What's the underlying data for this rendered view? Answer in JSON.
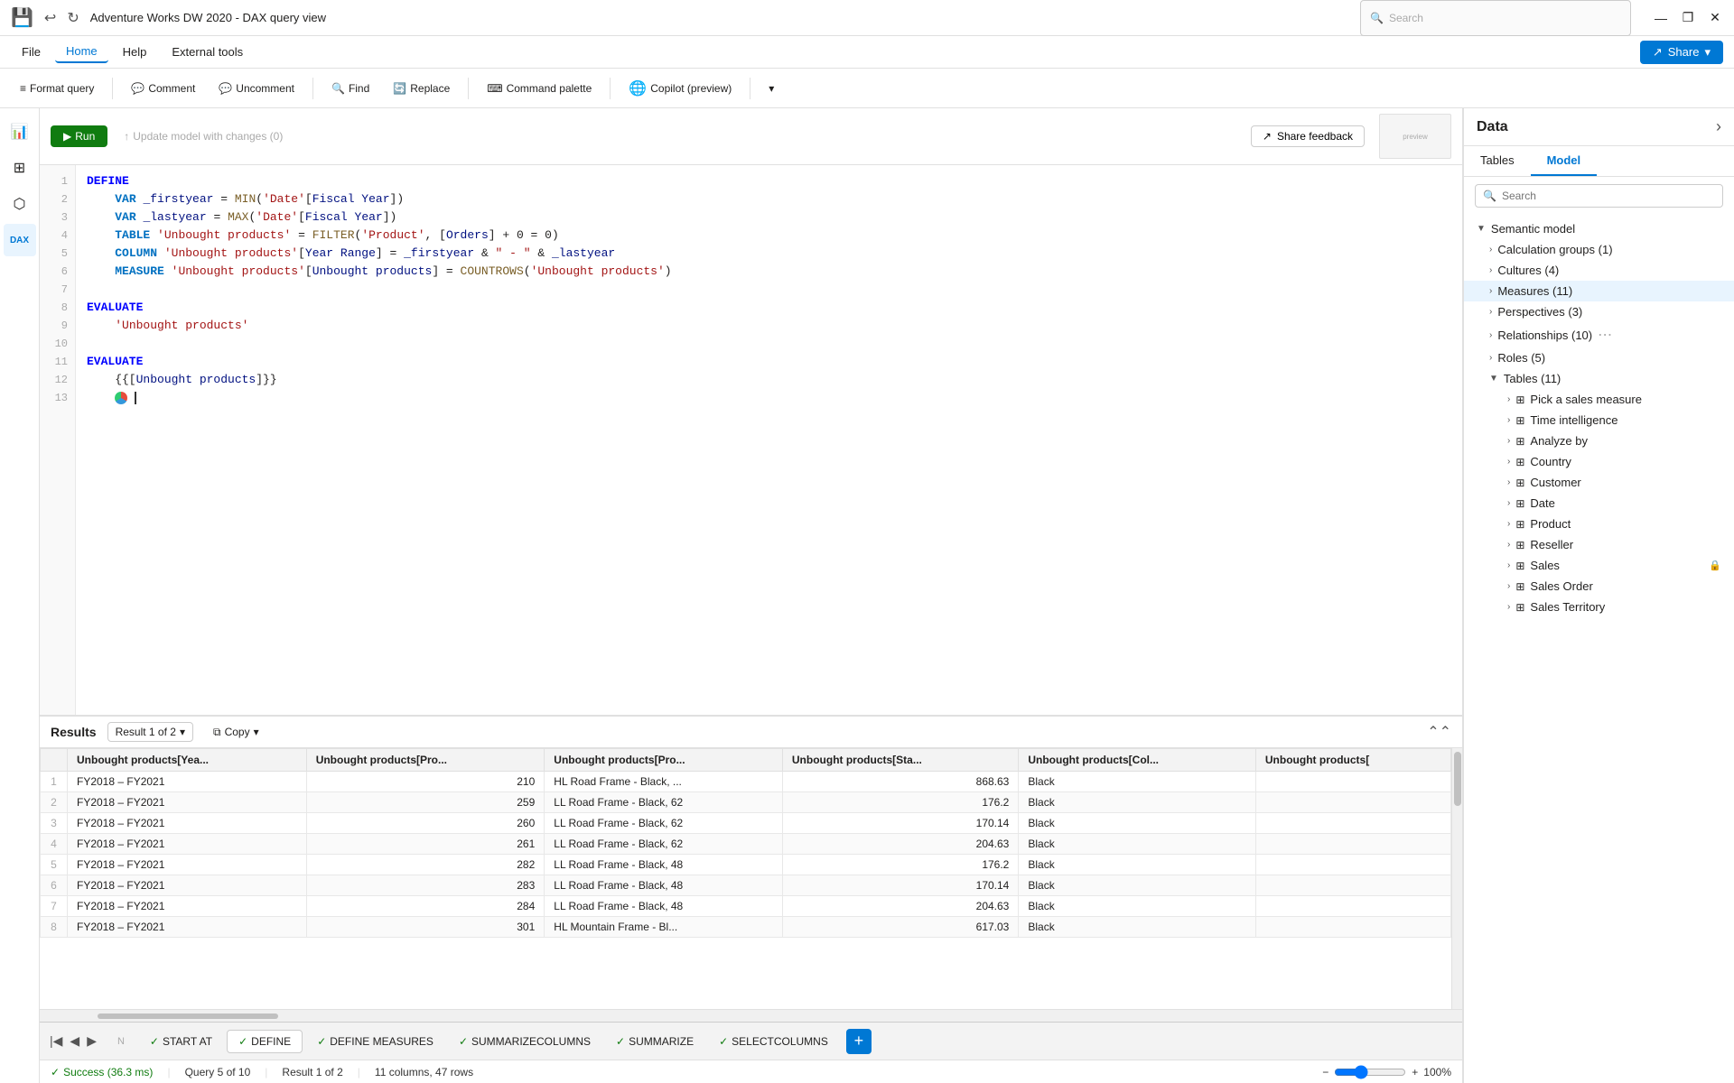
{
  "title_bar": {
    "title": "Adventure Works DW 2020 - DAX query view",
    "search_placeholder": "Search",
    "win_min": "—",
    "win_max": "❐",
    "win_close": "✕"
  },
  "menu": {
    "items": [
      "File",
      "Home",
      "Help",
      "External tools"
    ],
    "active": "Home",
    "share_label": "Share"
  },
  "toolbar": {
    "format_query": "Format query",
    "comment": "Comment",
    "uncomment": "Uncomment",
    "find": "Find",
    "replace": "Replace",
    "command_palette": "Command palette",
    "copilot": "Copilot (preview)",
    "run": "Run",
    "update_model": "Update model with changes (0)"
  },
  "feedback": {
    "share_feedback": "Share feedback"
  },
  "code": {
    "lines": [
      {
        "num": 1,
        "text": "DEFINE",
        "type": "keyword"
      },
      {
        "num": 2,
        "text": "    VAR _firstyear = MIN('Date'[Fiscal Year])",
        "type": "code"
      },
      {
        "num": 3,
        "text": "    VAR _lastyear = MAX('Date'[Fiscal Year])",
        "type": "code"
      },
      {
        "num": 4,
        "text": "    TABLE 'Unbought products' = FILTER('Product', [Orders] + 0 = 0)",
        "type": "code"
      },
      {
        "num": 5,
        "text": "    COLUMN 'Unbought products'[Year Range] = _firstyear & \" - \" & _lastyear",
        "type": "code"
      },
      {
        "num": 6,
        "text": "    MEASURE 'Unbought products'[Unbought products] = COUNTROWS('Unbought products')",
        "type": "code"
      },
      {
        "num": 7,
        "text": "",
        "type": "empty"
      },
      {
        "num": 8,
        "text": "EVALUATE",
        "type": "keyword"
      },
      {
        "num": 9,
        "text": "    'Unbought products'",
        "type": "code"
      },
      {
        "num": 10,
        "text": "",
        "type": "empty"
      },
      {
        "num": 11,
        "text": "EVALUATE",
        "type": "keyword"
      },
      {
        "num": 12,
        "text": "    {{[Unbought products]}}",
        "type": "code"
      },
      {
        "num": 13,
        "text": "    ",
        "type": "cursor"
      }
    ]
  },
  "results": {
    "title": "Results",
    "result_selector": "Result 1 of 2",
    "copy_label": "Copy",
    "columns": [
      "Unbought products[Yea...",
      "Unbought products[Pro...",
      "Unbought products[Pro...",
      "Unbought products[Sta...",
      "Unbought products[Col...",
      "Unbought products["
    ],
    "rows": [
      {
        "num": 1,
        "c1": "FY2018 – FY2021",
        "c2": "210",
        "c3": "HL Road Frame - Black, ...",
        "c4": "868.63",
        "c5": "Black",
        "c6": ""
      },
      {
        "num": 2,
        "c1": "FY2018 – FY2021",
        "c2": "259",
        "c3": "LL Road Frame - Black, 62",
        "c4": "176.2",
        "c5": "Black",
        "c6": ""
      },
      {
        "num": 3,
        "c1": "FY2018 – FY2021",
        "c2": "260",
        "c3": "LL Road Frame - Black, 62",
        "c4": "170.14",
        "c5": "Black",
        "c6": ""
      },
      {
        "num": 4,
        "c1": "FY2018 – FY2021",
        "c2": "261",
        "c3": "LL Road Frame - Black, 62",
        "c4": "204.63",
        "c5": "Black",
        "c6": ""
      },
      {
        "num": 5,
        "c1": "FY2018 – FY2021",
        "c2": "282",
        "c3": "LL Road Frame - Black, 48",
        "c4": "176.2",
        "c5": "Black",
        "c6": ""
      },
      {
        "num": 6,
        "c1": "FY2018 – FY2021",
        "c2": "283",
        "c3": "LL Road Frame - Black, 48",
        "c4": "170.14",
        "c5": "Black",
        "c6": ""
      },
      {
        "num": 7,
        "c1": "FY2018 – FY2021",
        "c2": "284",
        "c3": "LL Road Frame - Black, 48",
        "c4": "204.63",
        "c5": "Black",
        "c6": ""
      },
      {
        "num": 8,
        "c1": "FY2018 – FY2021",
        "c2": "301",
        "c3": "HL Mountain Frame - Bl...",
        "c4": "617.03",
        "c5": "Black",
        "c6": ""
      }
    ]
  },
  "bottom_tabs": {
    "items": [
      "N",
      "START AT",
      "DEFINE",
      "DEFINE MEASURES",
      "SUMMARIZECOLUMNS",
      "SUMMARIZE",
      "SELECTCOLUMNS"
    ],
    "active": "DEFINE"
  },
  "status_bar": {
    "success_text": "Success (36.3 ms)",
    "query_text": "Query 5 of 10",
    "result_text": "Result 1 of 2",
    "columns_rows": "11 columns, 47 rows",
    "zoom": "100%"
  },
  "data_panel": {
    "title": "Data",
    "tabs": [
      "Tables",
      "Model"
    ],
    "active_tab": "Model",
    "search_placeholder": "Search",
    "tree": [
      {
        "label": "Semantic model",
        "type": "root",
        "expanded": true
      },
      {
        "label": "Calculation groups (1)",
        "type": "child",
        "level": 1
      },
      {
        "label": "Cultures (4)",
        "type": "child",
        "level": 1
      },
      {
        "label": "Measures (11)",
        "type": "child",
        "level": 1,
        "active": true
      },
      {
        "label": "Perspectives (3)",
        "type": "child",
        "level": 1
      },
      {
        "label": "Relationships (10)",
        "type": "child",
        "level": 1
      },
      {
        "label": "Roles (5)",
        "type": "child",
        "level": 1
      },
      {
        "label": "Tables (11)",
        "type": "child",
        "level": 1,
        "expanded": true
      },
      {
        "label": "Pick a sales measure",
        "type": "table-child",
        "level": 2
      },
      {
        "label": "Time intelligence",
        "type": "table-child",
        "level": 2
      },
      {
        "label": "Analyze by",
        "type": "table-child",
        "level": 2
      },
      {
        "label": "Country",
        "type": "table-child",
        "level": 2
      },
      {
        "label": "Customer",
        "type": "table-child",
        "level": 2
      },
      {
        "label": "Date",
        "type": "table-child",
        "level": 2
      },
      {
        "label": "Product",
        "type": "table-child",
        "level": 2
      },
      {
        "label": "Reseller",
        "type": "table-child",
        "level": 2
      },
      {
        "label": "Sales",
        "type": "table-child",
        "level": 2
      },
      {
        "label": "Sales Order",
        "type": "table-child",
        "level": 2
      },
      {
        "label": "Sales Territory",
        "type": "table-child",
        "level": 2
      }
    ]
  }
}
